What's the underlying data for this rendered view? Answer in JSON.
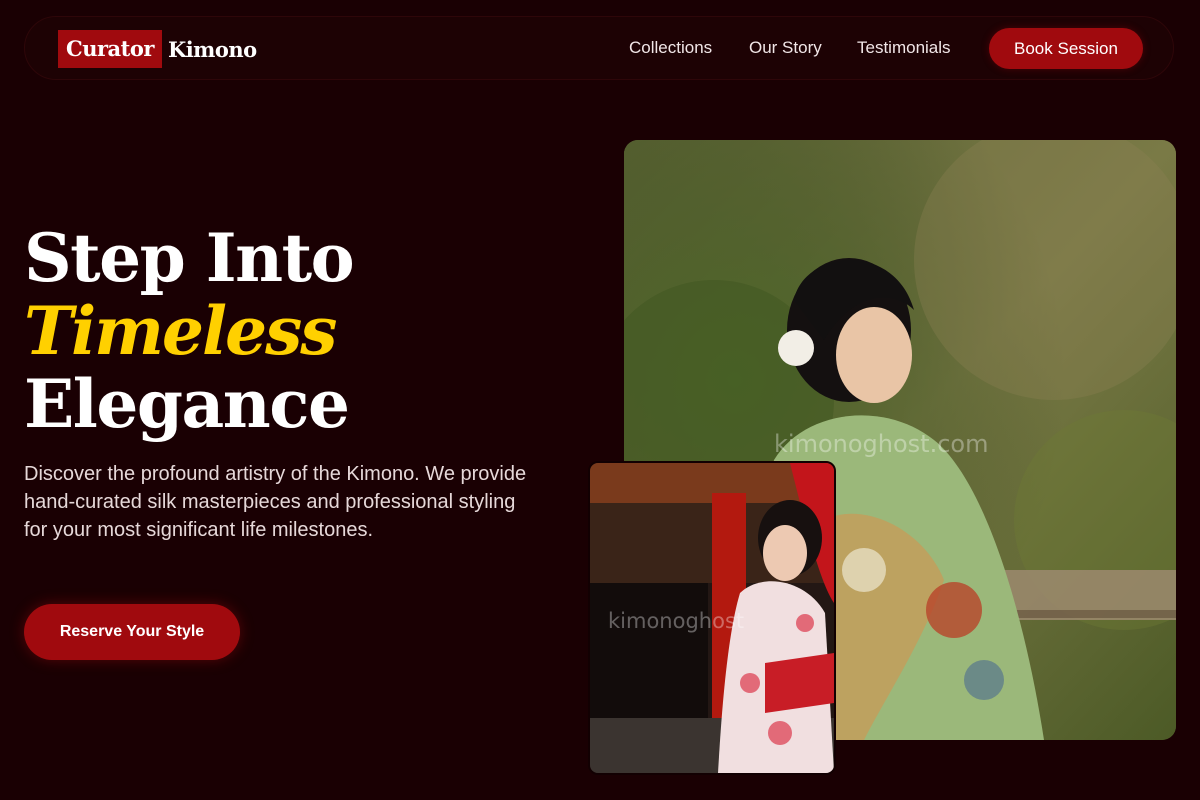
{
  "brand": {
    "logo_highlight": "Curator",
    "logo_word": "Kimono"
  },
  "nav": {
    "links": [
      "Collections",
      "Our Story",
      "Testimonials"
    ],
    "cta": "Book Session"
  },
  "hero": {
    "title_line1": "Step Into",
    "title_accent": "Timeless",
    "title_line3": "Elegance",
    "description": "Discover the profound artistry of the Kimono. We provide hand-curated silk masterpieces and professional styling for your most significant life milestones.",
    "cta": "Reserve Your Style"
  },
  "images": {
    "large_watermark": "kimonoghost.com",
    "small_watermark": "kimonoghost"
  },
  "colors": {
    "background": "#1a0003",
    "brand_red": "#a00a0e",
    "accent_gold": "#ffd000"
  }
}
